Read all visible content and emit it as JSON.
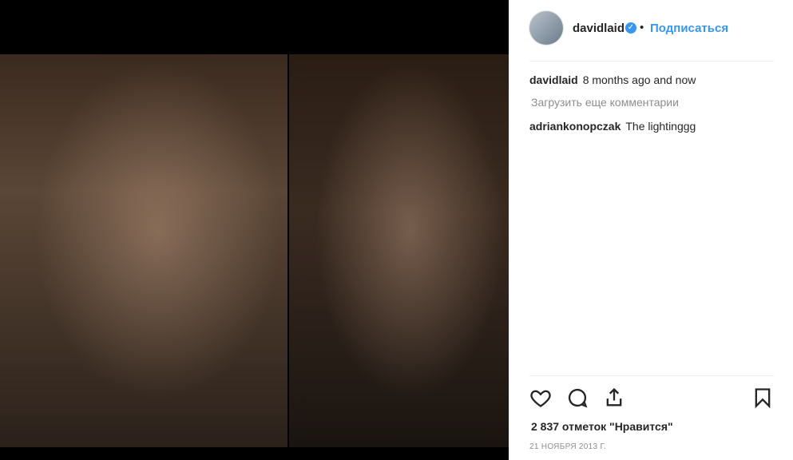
{
  "post": {
    "username": "davidlaid",
    "verified_icon": "verified-badge-icon",
    "separator": "•",
    "follow_label": "Подписаться"
  },
  "comments": [
    {
      "user": "davidlaid",
      "text": "8 months ago and now"
    },
    {
      "user": "adriankonopczak",
      "text": "The lightinggg"
    }
  ],
  "load_more_label": "Загрузить еще комментарии",
  "actions": {
    "like_icon": "heart-icon",
    "comment_icon": "comment-icon",
    "share_icon": "share-icon",
    "save_icon": "bookmark-icon"
  },
  "likes_text": "2 837 отметок \"Нравится\"",
  "date_text": "21 НОЯБРЯ 2013 Г.",
  "colors": {
    "link": "#3897f0",
    "text": "#262626",
    "muted": "#8e8e8e"
  }
}
